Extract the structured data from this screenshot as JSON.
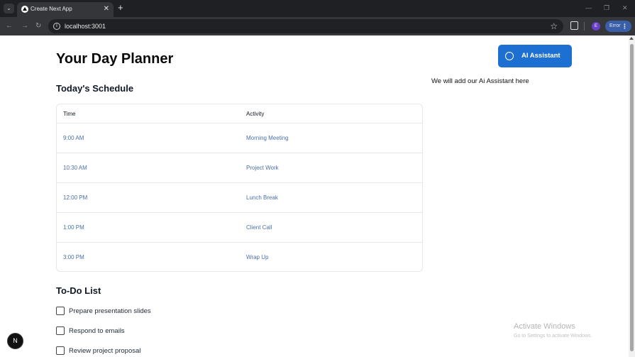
{
  "browser": {
    "tab_title": "Create Next App",
    "tab_close": "✕",
    "new_tab": "+",
    "tab_menu": "⌄",
    "url": "localhost:3001",
    "profile_initial": "E",
    "error_label": "Error",
    "minimize": "—",
    "restore": "❐",
    "close": "✕",
    "back": "←",
    "forward": "→",
    "reload": "↻",
    "star": "☆"
  },
  "page": {
    "title": "Your Day Planner",
    "schedule": {
      "title": "Today's Schedule",
      "columns": [
        "Time",
        "Activity"
      ],
      "rows": [
        {
          "time": "9:00 AM",
          "activity": "Morning Meeting"
        },
        {
          "time": "10:30 AM",
          "activity": "Project Work"
        },
        {
          "time": "12:00 PM",
          "activity": "Lunch Break"
        },
        {
          "time": "1:00 PM",
          "activity": "Client Call"
        },
        {
          "time": "3:00 PM",
          "activity": "Wrap Up"
        }
      ]
    },
    "todo": {
      "title": "To-Do List",
      "items": [
        {
          "label": "Prepare presentation slides",
          "checked": false
        },
        {
          "label": "Respond to emails",
          "checked": false
        },
        {
          "label": "Review project proposal",
          "checked": false
        }
      ]
    },
    "assistant": {
      "button_label": "AI Assistant",
      "note": "We will add our Ai Assistant here"
    },
    "next_badge": "N"
  },
  "os": {
    "watermark_title": "Activate Windows",
    "watermark_sub": "Go to Settings to activate Windows."
  },
  "colors": {
    "accent": "#1d6fd1",
    "link_text": "#4b6fa8",
    "chrome_dark": "#1f2023"
  }
}
